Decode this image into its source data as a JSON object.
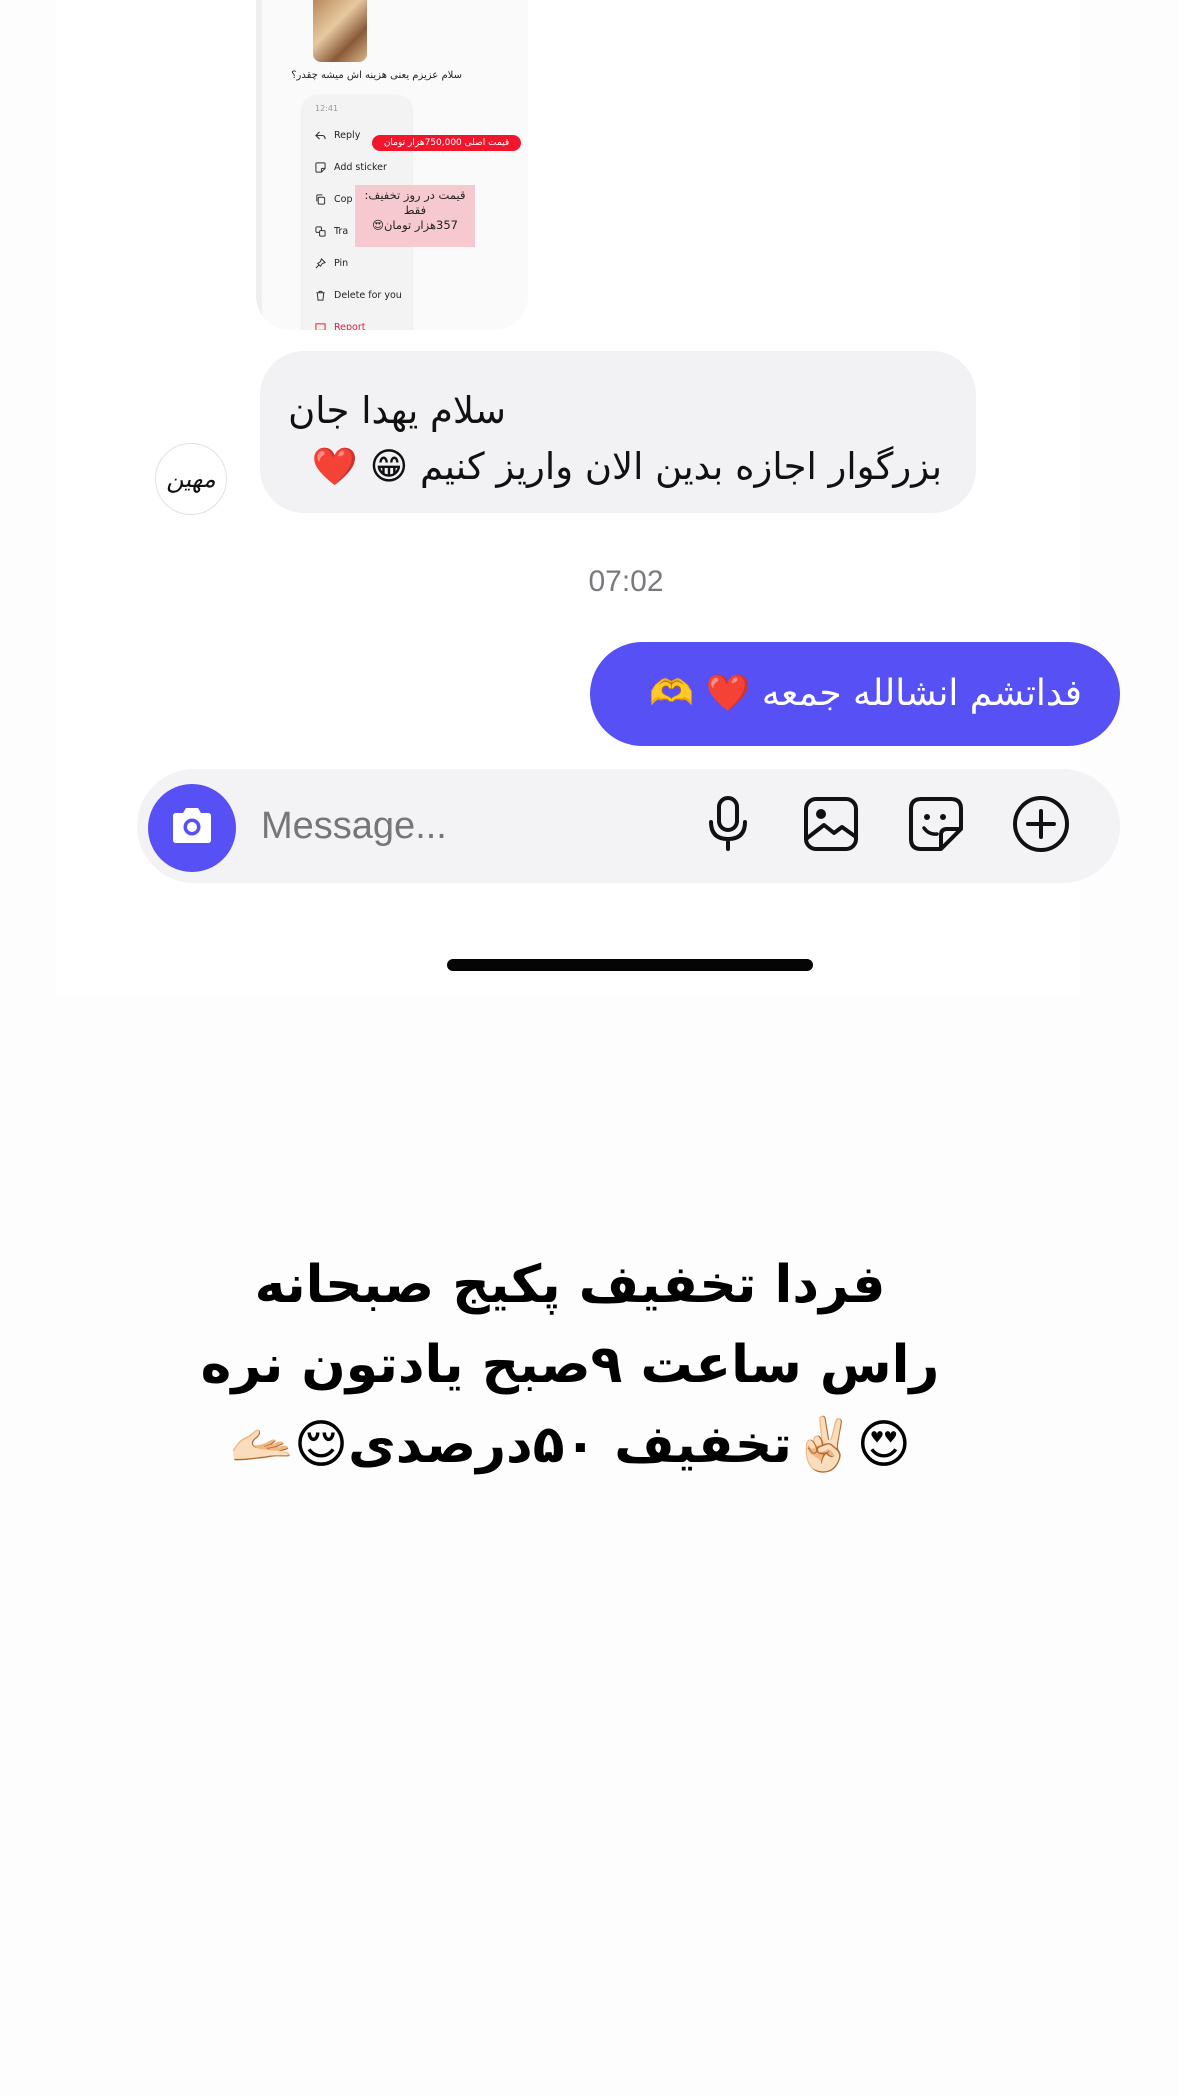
{
  "shared_image": {
    "question_text": "سلام عزیزم یعنی هزینه اش میشه چقدر؟",
    "menu_time": "12:41",
    "menu_items": [
      {
        "label": "Reply",
        "icon": "reply-icon"
      },
      {
        "label": "Add sticker",
        "icon": "sticker-icon"
      },
      {
        "label": "Cop",
        "icon": "copy-icon"
      },
      {
        "label": "Tra",
        "icon": "translate-icon"
      },
      {
        "label": "Pin",
        "icon": "pin-icon"
      },
      {
        "label": "Delete for you",
        "icon": "trash-icon"
      },
      {
        "label": "Report",
        "icon": "report-icon"
      }
    ],
    "original_price_label": "قیمت اصلی 750,000هزار تومان",
    "discount_price_line1": "قیمت در روز تخفیف:",
    "discount_price_line2": "فقط",
    "discount_price_line3": "357هزار تومان😍"
  },
  "incoming_message": {
    "avatar_text": "مهین",
    "line1": "سلام یهدا جان",
    "line2_text": "بزرگوار اجازه بدین الان واریز کنیم",
    "line2_emoji_grin": "😁",
    "line2_emoji_heart": "❤️"
  },
  "timestamp": "07:02",
  "outgoing_message": {
    "text": "فداتشم انشالله جمعه",
    "emoji_heart": "❤️",
    "emoji_hands": "🫶"
  },
  "composer": {
    "placeholder": "Message...",
    "icons": [
      "camera-icon",
      "microphone-icon",
      "gallery-icon",
      "sticker-icon",
      "add-icon"
    ]
  },
  "caption": {
    "line1": "فردا تخفیف پکیج صبحانه",
    "line2": "راس ساعت ۹صبح یادتون نره",
    "line3": "😍✌🏻تخفیف ۵۰درصدی😌🫴🏻"
  },
  "colors": {
    "accent": "#5750f5",
    "incoming_bubble": "#f2f2f4",
    "price_red": "#f0172d",
    "price_pink": "#f5c9cf"
  }
}
